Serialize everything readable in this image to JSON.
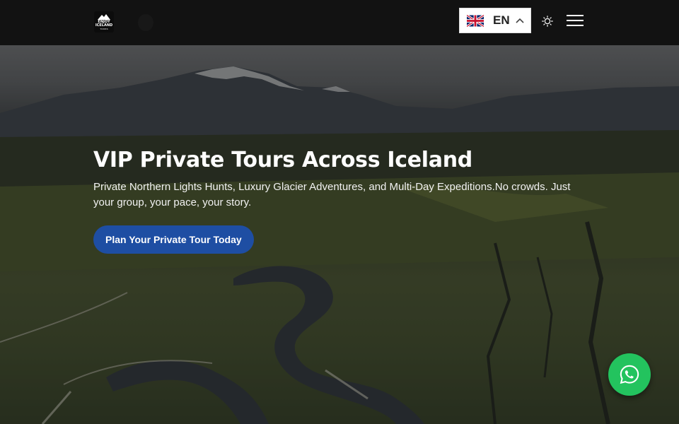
{
  "header": {
    "logo_line1": "ENJOY",
    "logo_line2": "ICELAND",
    "logo_line3": "TOURS",
    "language_code": "EN",
    "language_flag": "uk-flag-icon",
    "theme_icon": "sun-icon",
    "menu_icon": "hamburger-menu-icon"
  },
  "hero": {
    "title": "VIP Private Tours Across Iceland",
    "description": "Private Northern Lights Hunts, Luxury Glacier Adventures, and Multi-Day Expeditions.No crowds. Just your group, your pace, your story.",
    "cta_label": "Plan Your Private Tour Today"
  },
  "floating": {
    "whatsapp_icon": "whatsapp-icon"
  },
  "colors": {
    "header_bg": "#121212",
    "cta_bg": "#1e4ea3",
    "whatsapp_bg": "#23c35e"
  }
}
